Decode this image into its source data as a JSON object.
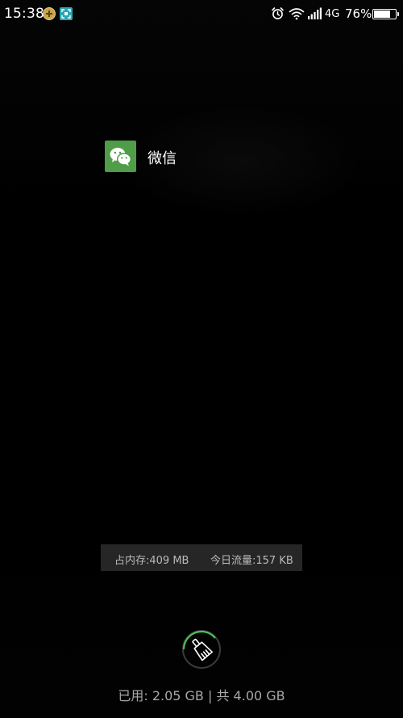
{
  "status_bar": {
    "time": "15:38",
    "network_type": "4G",
    "battery_percent": "76%",
    "battery_level": 0.76,
    "icons": [
      "notification-plus-icon",
      "notification-scan-icon",
      "alarm-icon",
      "wifi-icon",
      "signal-icon",
      "battery-icon"
    ]
  },
  "recent_apps": [
    {
      "name": "微信",
      "icon": "wechat-icon",
      "icon_color": "#4f9d48"
    }
  ],
  "memory_bar": {
    "memory_usage": "占内存:409 MB",
    "data_usage": "今日流量:157 KB"
  },
  "clear_button": {
    "icon": "broom-icon",
    "ring_color": "#4cbf57"
  },
  "storage_text": "已用: 2.05 GB | 共 4.00 GB"
}
